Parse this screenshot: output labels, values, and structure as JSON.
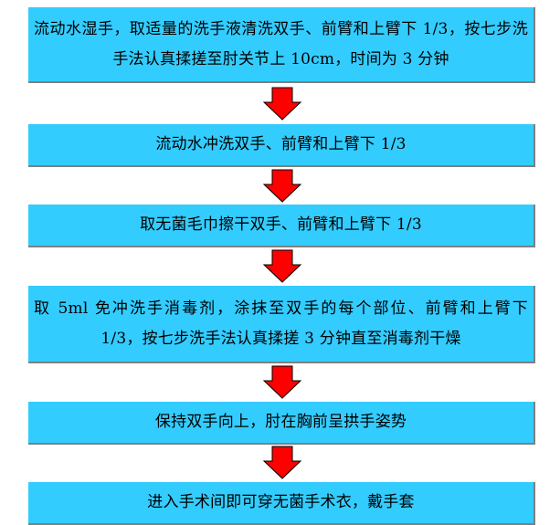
{
  "steps": [
    {
      "text": "流动水湿手，取适量的洗手液清洗双手、前臂和上臂下 1/3，按七步洗手法认真揉搓至肘关节上 10cm，时间为 3 分钟"
    },
    {
      "text": "流动水冲洗双手、前臂和上臂下 1/3"
    },
    {
      "text": "取无菌毛巾擦干双手、前臂和上臂下 1/3"
    },
    {
      "text": "取 5ml 免冲洗手消毒剂，涂抹至双手的每个部位、前臂和上臂下 1/3，按七步洗手法认真揉搓 3 分钟直至消毒剂干燥"
    },
    {
      "text": "保持双手向上，肘在胸前呈拱手姿势"
    },
    {
      "text": "进入手术间即可穿无菌手术衣，戴手套"
    }
  ],
  "colors": {
    "box_fill": "#33ccff",
    "box_shadow": "#7f7f7f",
    "arrow_fill": "#ff0000",
    "arrow_stroke": "#000000"
  },
  "icons": {
    "arrow": "down-arrow-icon"
  }
}
